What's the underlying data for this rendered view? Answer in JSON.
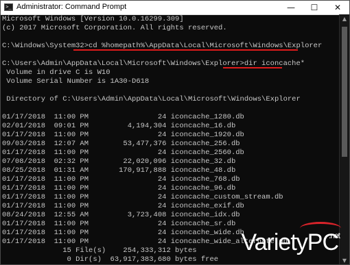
{
  "window": {
    "title": "Administrator: Command Prompt"
  },
  "controls": {
    "minimize": "—",
    "maximize": "☐",
    "close": "✕"
  },
  "console": {
    "lines": [
      "Microsoft Windows [Version 10.0.16299.309]",
      "(c) 2017 Microsoft Corporation. All rights reserved.",
      "",
      "C:\\Windows\\System32>cd %homepath%\\AppData\\Local\\Microsoft\\Windows\\Explorer",
      "",
      "C:\\Users\\Admin\\AppData\\Local\\Microsoft\\Windows\\Explorer>dir iconcache*",
      " Volume in drive C is W10",
      " Volume Serial Number is 1A30-D618",
      "",
      " Directory of C:\\Users\\Admin\\AppData\\Local\\Microsoft\\Windows\\Explorer",
      "",
      "01/17/2018  11:00 PM                24 iconcache_1280.db",
      "02/01/2018  09:01 PM         4,194,304 iconcache_16.db",
      "01/17/2018  11:00 PM                24 iconcache_1920.db",
      "09/03/2018  12:07 AM        53,477,376 iconcache_256.db",
      "01/17/2018  11:00 PM                24 iconcache_2560.db",
      "07/08/2018  02:32 PM        22,020,096 iconcache_32.db",
      "08/25/2018  01:31 AM       170,917,888 iconcache_48.db",
      "01/17/2018  11:00 PM                24 iconcache_768.db",
      "01/17/2018  11:00 PM                24 iconcache_96.db",
      "01/17/2018  11:00 PM                24 iconcache_custom_stream.db",
      "01/17/2018  11:00 PM                24 iconcache_exif.db",
      "08/24/2018  12:55 AM         3,723,408 iconcache_idx.db",
      "01/17/2018  11:00 PM                24 iconcache_sr.db",
      "01/17/2018  11:00 PM                24 iconcache_wide.db",
      "01/17/2018  11:00 PM                24 iconcache_wide_alternate.db",
      "              15 File(s)    254,333,312 bytes",
      "               0 Dir(s)  63,917,383,680 bytes free"
    ]
  },
  "watermark": {
    "brand": "Variety",
    "brand_suffix": "PC",
    "tld": ".net"
  },
  "colors": {
    "console_bg": "#0c0c0c",
    "console_text": "#c8c8c8",
    "highlight": "#e01b1b"
  }
}
